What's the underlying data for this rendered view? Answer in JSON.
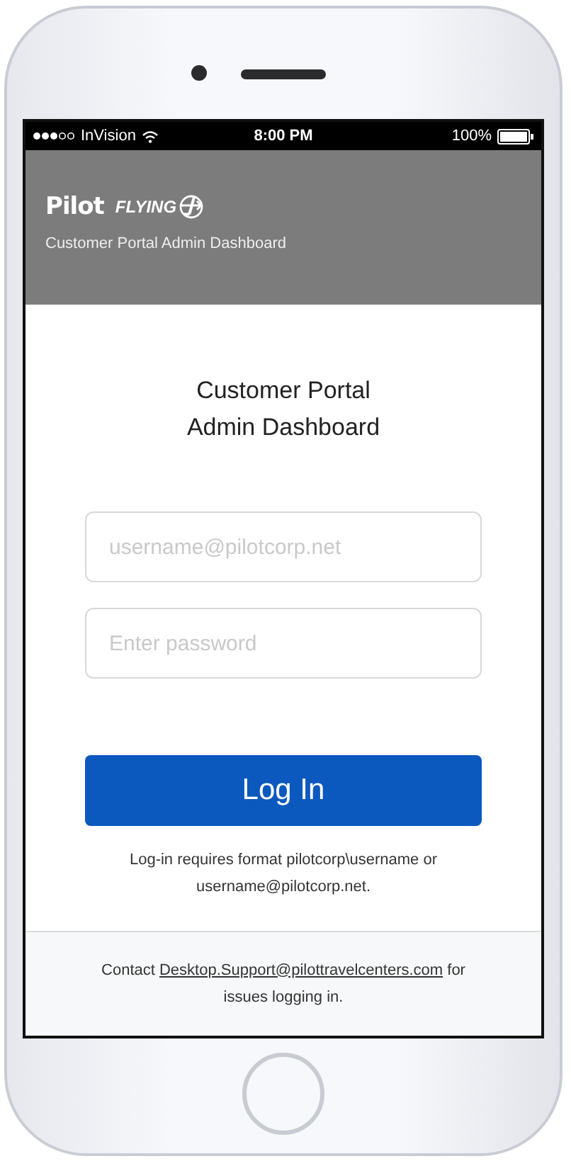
{
  "status_bar": {
    "carrier": "InVision",
    "time": "8:00 PM",
    "battery": "100%"
  },
  "header": {
    "logos": [
      "Pilot",
      "FLYING"
    ],
    "subtitle": "Customer Portal Admin Dashboard"
  },
  "login": {
    "title": "Customer Portal\nAdmin Dashboard",
    "fields": [
      {
        "placeholder": "username@pilotcorp.net"
      },
      {
        "placeholder": "Enter password"
      }
    ],
    "button": "Log In",
    "note": "Log-in requires format pilotcorp\\username or username@pilotcorp.net."
  },
  "footer": {
    "before": "Contact ",
    "link": "Desktop.Support@pilottravelcenters.com",
    "after": " for issues logging in."
  }
}
